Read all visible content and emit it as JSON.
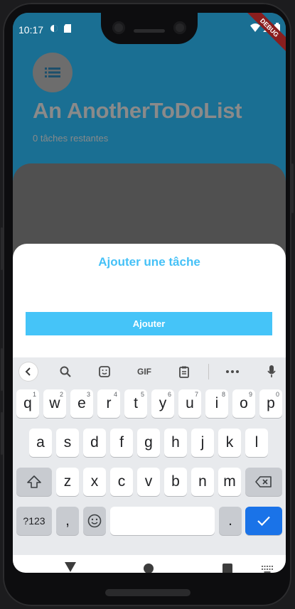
{
  "status_bar": {
    "time": "10:17"
  },
  "debug_banner": "DEBUG",
  "app": {
    "title": "An AnotherToDoList",
    "subtitle": "0 tâches restantes"
  },
  "sheet": {
    "title": "Ajouter une tâche",
    "input_value": "",
    "button_label": "Ajouter"
  },
  "keyboard": {
    "toolbar": [
      "back",
      "search",
      "sticker",
      "GIF",
      "clipboard",
      "more",
      "mic"
    ],
    "row1": [
      {
        "k": "q",
        "h": "1"
      },
      {
        "k": "w",
        "h": "2"
      },
      {
        "k": "e",
        "h": "3"
      },
      {
        "k": "r",
        "h": "4"
      },
      {
        "k": "t",
        "h": "5"
      },
      {
        "k": "y",
        "h": "6"
      },
      {
        "k": "u",
        "h": "7"
      },
      {
        "k": "i",
        "h": "8"
      },
      {
        "k": "o",
        "h": "9"
      },
      {
        "k": "p",
        "h": "0"
      }
    ],
    "row2": [
      "a",
      "s",
      "d",
      "f",
      "g",
      "h",
      "j",
      "k",
      "l"
    ],
    "row3": [
      "z",
      "x",
      "c",
      "v",
      "b",
      "n",
      "m"
    ],
    "sym_label": "?123",
    "comma": ",",
    "period": "."
  },
  "colors": {
    "accent": "#45c1f7",
    "input_line": "#2aa3e6",
    "enter_key": "#1a73e8"
  }
}
